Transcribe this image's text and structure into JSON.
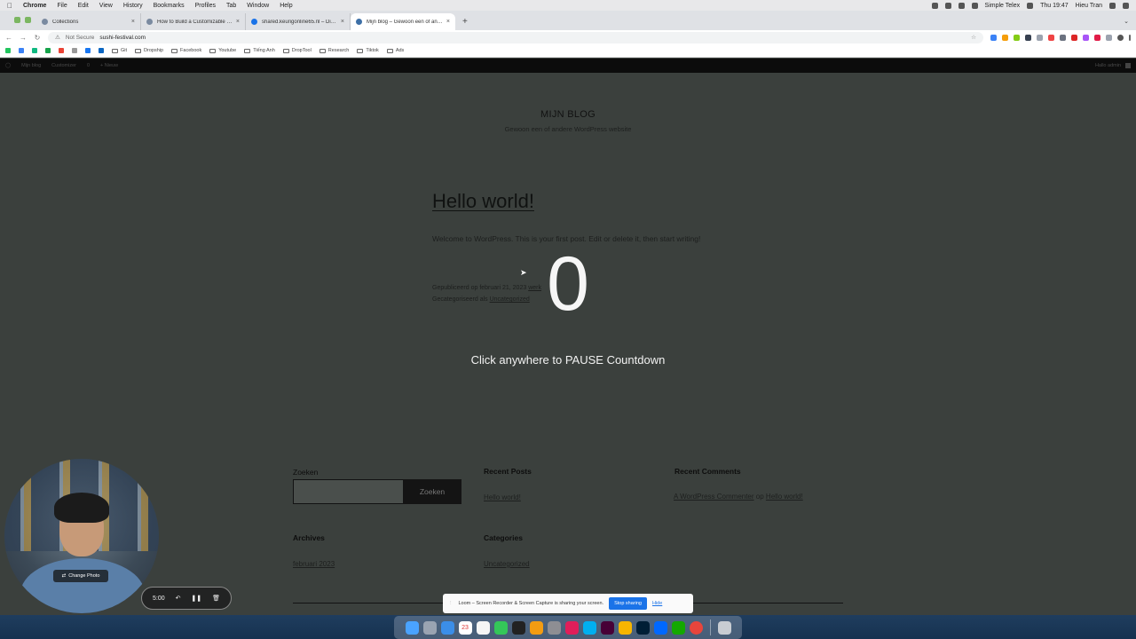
{
  "menubar": {
    "apple_icon": "",
    "items": [
      "Chrome",
      "File",
      "Edit",
      "View",
      "History",
      "Bookmarks",
      "Profiles",
      "Tab",
      "Window",
      "Help"
    ],
    "status_right": [
      "Simple Telex",
      "Thu 19:47",
      "Hieu Tran"
    ]
  },
  "browser": {
    "tabs": [
      {
        "title": "Collections",
        "active": false
      },
      {
        "title": "How to Build a Customizable F…",
        "active": false
      },
      {
        "title": "shared.keurigonline65.nl – Dire…",
        "active": false
      },
      {
        "title": "Mijn blog – Gewoon een of and…",
        "active": true
      }
    ],
    "new_tab": "+",
    "address": {
      "security_label": "Not Secure",
      "url": "sushi-festival.com"
    },
    "bookmarks": [
      "Git",
      "Dropship",
      "Facebook",
      "Youtube",
      "Tiếng Anh",
      "DropTool",
      "Research",
      "Tiktok",
      "Ads"
    ]
  },
  "adminbar": {
    "items": [
      "Mijn blog",
      "Customizer",
      "0",
      "+ Nieuw"
    ],
    "greeting": "Hallo admin"
  },
  "site": {
    "title": "MIJN BLOG",
    "tagline": "Gewoon een of andere WordPress website"
  },
  "post": {
    "title": "Hello world!",
    "excerpt": "Welcome to WordPress. This is your first post. Edit or delete it, then start writing!",
    "published_prefix": "Gepubliceerd op februari 21, 2023",
    "author_link": "werk",
    "category_prefix": "Gecategoriseerd als",
    "category_link": "Uncategorized"
  },
  "countdown": {
    "digit": "0",
    "message": "Click anywhere to PAUSE Countdown"
  },
  "widgets": {
    "search_heading": "Zoeken",
    "search_button": "Zoeken",
    "recent_posts_heading": "Recent Posts",
    "recent_post_item": "Hello world!",
    "recent_comments_heading": "Recent Comments",
    "comment_author": "A WordPress Commenter",
    "comment_on": "op",
    "comment_post": "Hello world!",
    "archives_heading": "Archives",
    "archive_item": "februari 2023",
    "categories_heading": "Categories",
    "category_item": "Uncategorized"
  },
  "loom": {
    "change_photo": "Change Photo",
    "timer": "5:00",
    "share_text": "Loom – Screen Recorder & Screen Capture is sharing your screen.",
    "stop_sharing": "Stop sharing",
    "hide": "Hide"
  },
  "dock": {
    "date_badge": "23"
  },
  "colors": {
    "page_bg": "#3b403d",
    "accent_blue": "#1a73e8"
  }
}
